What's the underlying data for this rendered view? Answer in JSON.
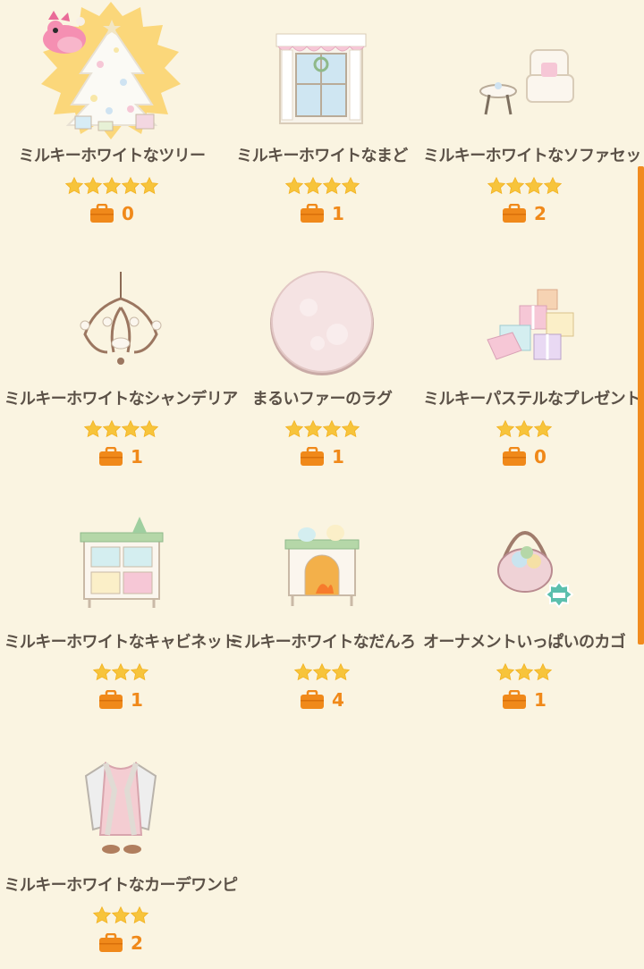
{
  "accent_color": "#f0891a",
  "star_color": "#f7c43b",
  "items": [
    {
      "name": "ミルキーホワイトなツリー",
      "stars": 5,
      "owned": "0",
      "icon": "christmas-tree-icon"
    },
    {
      "name": "ミルキーホワイトなまど",
      "stars": 4,
      "owned": "1",
      "icon": "window-icon"
    },
    {
      "name": "ミルキーホワイトなソファセット",
      "stars": 4,
      "owned": "2",
      "icon": "sofa-set-icon"
    },
    {
      "name": "ミルキーホワイトなシャンデリア",
      "stars": 4,
      "owned": "1",
      "icon": "chandelier-icon"
    },
    {
      "name": "まるいファーのラグ",
      "stars": 4,
      "owned": "1",
      "icon": "round-rug-icon"
    },
    {
      "name": "ミルキーパステルなプレゼント",
      "stars": 3,
      "owned": "0",
      "icon": "presents-icon"
    },
    {
      "name": "ミルキーホワイトなキャビネット",
      "stars": 3,
      "owned": "1",
      "icon": "cabinet-icon"
    },
    {
      "name": "ミルキーホワイトなだんろ",
      "stars": 3,
      "owned": "4",
      "icon": "fireplace-icon"
    },
    {
      "name": "オーナメントいっぱいのカゴ",
      "stars": 3,
      "owned": "1",
      "icon": "ornament-basket-icon"
    },
    {
      "name": "ミルキーホワイトなカーデワンピ",
      "stars": 3,
      "owned": "2",
      "icon": "cardigan-dress-icon"
    }
  ]
}
